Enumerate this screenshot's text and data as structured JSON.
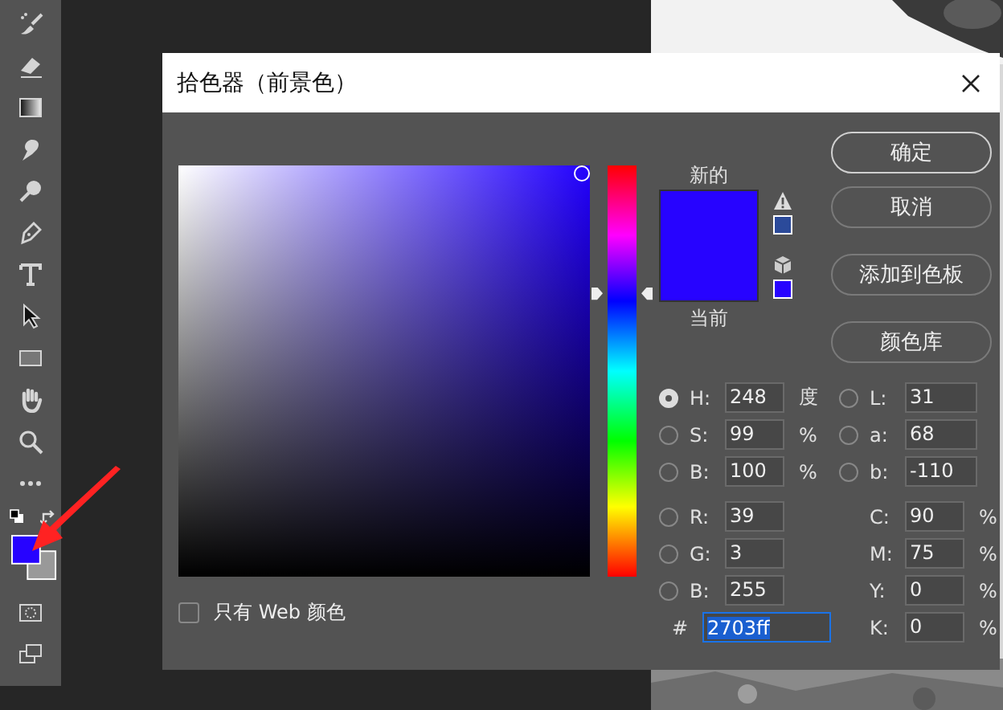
{
  "dialog": {
    "title": "拾色器（前景色）",
    "hue_slider": {
      "level": 0.689
    },
    "preview": {
      "new_label": "新的",
      "current_label": "当前"
    },
    "buttons": [
      {
        "label": "确定",
        "kind": "primary"
      },
      {
        "label": "取消",
        "kind": "normal"
      },
      {
        "label": "添加到色板",
        "kind": "normal"
      },
      {
        "label": "颜色库",
        "kind": "normal"
      }
    ],
    "web_colors_only": {
      "label": "只有 Web 颜色",
      "checked": false
    },
    "hsb": [
      {
        "label": "H:",
        "value": "248",
        "unit": "度",
        "selected": true
      },
      {
        "label": "S:",
        "value": "99",
        "unit": "%",
        "selected": false
      },
      {
        "label": "B:",
        "value": "100",
        "unit": "%",
        "selected": false
      }
    ],
    "lab": [
      {
        "label": "L:",
        "value": "31",
        "selected": false
      },
      {
        "label": "a:",
        "value": "68",
        "selected": false
      },
      {
        "label": "b:",
        "value": "-110",
        "selected": false
      }
    ],
    "rgb": [
      {
        "label": "R:",
        "value": "39",
        "selected": false
      },
      {
        "label": "G:",
        "value": "3",
        "selected": false
      },
      {
        "label": "B:",
        "value": "255",
        "selected": false
      }
    ],
    "cmyk": [
      {
        "label": "C:",
        "value": "90",
        "unit": "%"
      },
      {
        "label": "M:",
        "value": "75",
        "unit": "%"
      },
      {
        "label": "Y:",
        "value": "0",
        "unit": "%"
      },
      {
        "label": "K:",
        "value": "0",
        "unit": "%"
      }
    ],
    "hex": {
      "label": "#",
      "value": "2703ff"
    }
  }
}
